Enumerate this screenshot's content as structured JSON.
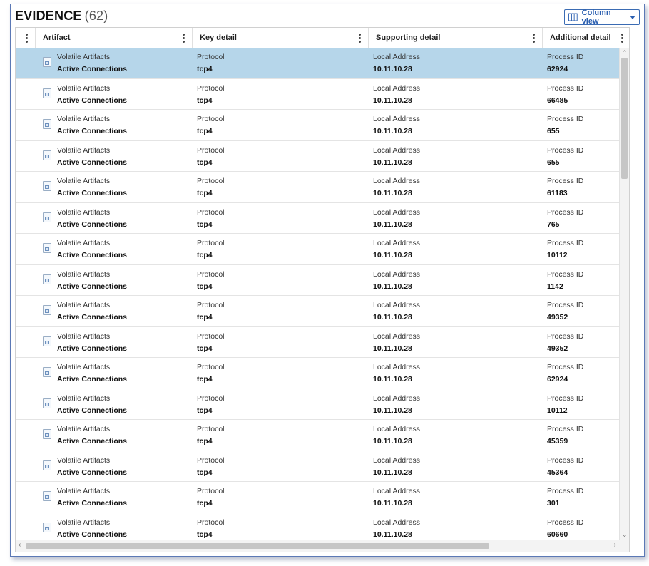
{
  "header": {
    "title": "EVIDENCE",
    "count": "(62)",
    "column_view_label": "Column view"
  },
  "columns": [
    {
      "key": "artifact",
      "label": "Artifact"
    },
    {
      "key": "key_detail",
      "label": "Key detail"
    },
    {
      "key": "supporting_detail",
      "label": "Supporting detail"
    },
    {
      "key": "additional_detail",
      "label": "Additional detail"
    }
  ],
  "rows": [
    {
      "artifact_type": "Volatile Artifacts",
      "artifact_name": "Active Connections",
      "key_label": "Protocol",
      "key_value": "tcp4",
      "support_label": "Local Address",
      "support_value": "10.11.10.28",
      "add_label": "Process ID",
      "add_value": "62924",
      "selected": true
    },
    {
      "artifact_type": "Volatile Artifacts",
      "artifact_name": "Active Connections",
      "key_label": "Protocol",
      "key_value": "tcp4",
      "support_label": "Local Address",
      "support_value": "10.11.10.28",
      "add_label": "Process ID",
      "add_value": "66485"
    },
    {
      "artifact_type": "Volatile Artifacts",
      "artifact_name": "Active Connections",
      "key_label": "Protocol",
      "key_value": "tcp4",
      "support_label": "Local Address",
      "support_value": "10.11.10.28",
      "add_label": "Process ID",
      "add_value": "655"
    },
    {
      "artifact_type": "Volatile Artifacts",
      "artifact_name": "Active Connections",
      "key_label": "Protocol",
      "key_value": "tcp4",
      "support_label": "Local Address",
      "support_value": "10.11.10.28",
      "add_label": "Process ID",
      "add_value": "655"
    },
    {
      "artifact_type": "Volatile Artifacts",
      "artifact_name": "Active Connections",
      "key_label": "Protocol",
      "key_value": "tcp4",
      "support_label": "Local Address",
      "support_value": "10.11.10.28",
      "add_label": "Process ID",
      "add_value": "61183"
    },
    {
      "artifact_type": "Volatile Artifacts",
      "artifact_name": "Active Connections",
      "key_label": "Protocol",
      "key_value": "tcp4",
      "support_label": "Local Address",
      "support_value": "10.11.10.28",
      "add_label": "Process ID",
      "add_value": "765"
    },
    {
      "artifact_type": "Volatile Artifacts",
      "artifact_name": "Active Connections",
      "key_label": "Protocol",
      "key_value": "tcp4",
      "support_label": "Local Address",
      "support_value": "10.11.10.28",
      "add_label": "Process ID",
      "add_value": "10112"
    },
    {
      "artifact_type": "Volatile Artifacts",
      "artifact_name": "Active Connections",
      "key_label": "Protocol",
      "key_value": "tcp4",
      "support_label": "Local Address",
      "support_value": "10.11.10.28",
      "add_label": "Process ID",
      "add_value": "1142"
    },
    {
      "artifact_type": "Volatile Artifacts",
      "artifact_name": "Active Connections",
      "key_label": "Protocol",
      "key_value": "tcp4",
      "support_label": "Local Address",
      "support_value": "10.11.10.28",
      "add_label": "Process ID",
      "add_value": "49352"
    },
    {
      "artifact_type": "Volatile Artifacts",
      "artifact_name": "Active Connections",
      "key_label": "Protocol",
      "key_value": "tcp4",
      "support_label": "Local Address",
      "support_value": "10.11.10.28",
      "add_label": "Process ID",
      "add_value": "49352"
    },
    {
      "artifact_type": "Volatile Artifacts",
      "artifact_name": "Active Connections",
      "key_label": "Protocol",
      "key_value": "tcp4",
      "support_label": "Local Address",
      "support_value": "10.11.10.28",
      "add_label": "Process ID",
      "add_value": "62924"
    },
    {
      "artifact_type": "Volatile Artifacts",
      "artifact_name": "Active Connections",
      "key_label": "Protocol",
      "key_value": "tcp4",
      "support_label": "Local Address",
      "support_value": "10.11.10.28",
      "add_label": "Process ID",
      "add_value": "10112"
    },
    {
      "artifact_type": "Volatile Artifacts",
      "artifact_name": "Active Connections",
      "key_label": "Protocol",
      "key_value": "tcp4",
      "support_label": "Local Address",
      "support_value": "10.11.10.28",
      "add_label": "Process ID",
      "add_value": "45359"
    },
    {
      "artifact_type": "Volatile Artifacts",
      "artifact_name": "Active Connections",
      "key_label": "Protocol",
      "key_value": "tcp4",
      "support_label": "Local Address",
      "support_value": "10.11.10.28",
      "add_label": "Process ID",
      "add_value": "45364"
    },
    {
      "artifact_type": "Volatile Artifacts",
      "artifact_name": "Active Connections",
      "key_label": "Protocol",
      "key_value": "tcp4",
      "support_label": "Local Address",
      "support_value": "10.11.10.28",
      "add_label": "Process ID",
      "add_value": "301"
    },
    {
      "artifact_type": "Volatile Artifacts",
      "artifact_name": "Active Connections",
      "key_label": "Protocol",
      "key_value": "tcp4",
      "support_label": "Local Address",
      "support_value": "10.11.10.28",
      "add_label": "Process ID",
      "add_value": "60660"
    }
  ],
  "icons": {
    "column_view": "columns-icon",
    "column_menu": "kebab-menu-icon",
    "row_artifact": "document-icon"
  },
  "colors": {
    "accent": "#2b5fb0",
    "selected_row": "#b6d6ea",
    "frame_border": "#5b78b5"
  }
}
